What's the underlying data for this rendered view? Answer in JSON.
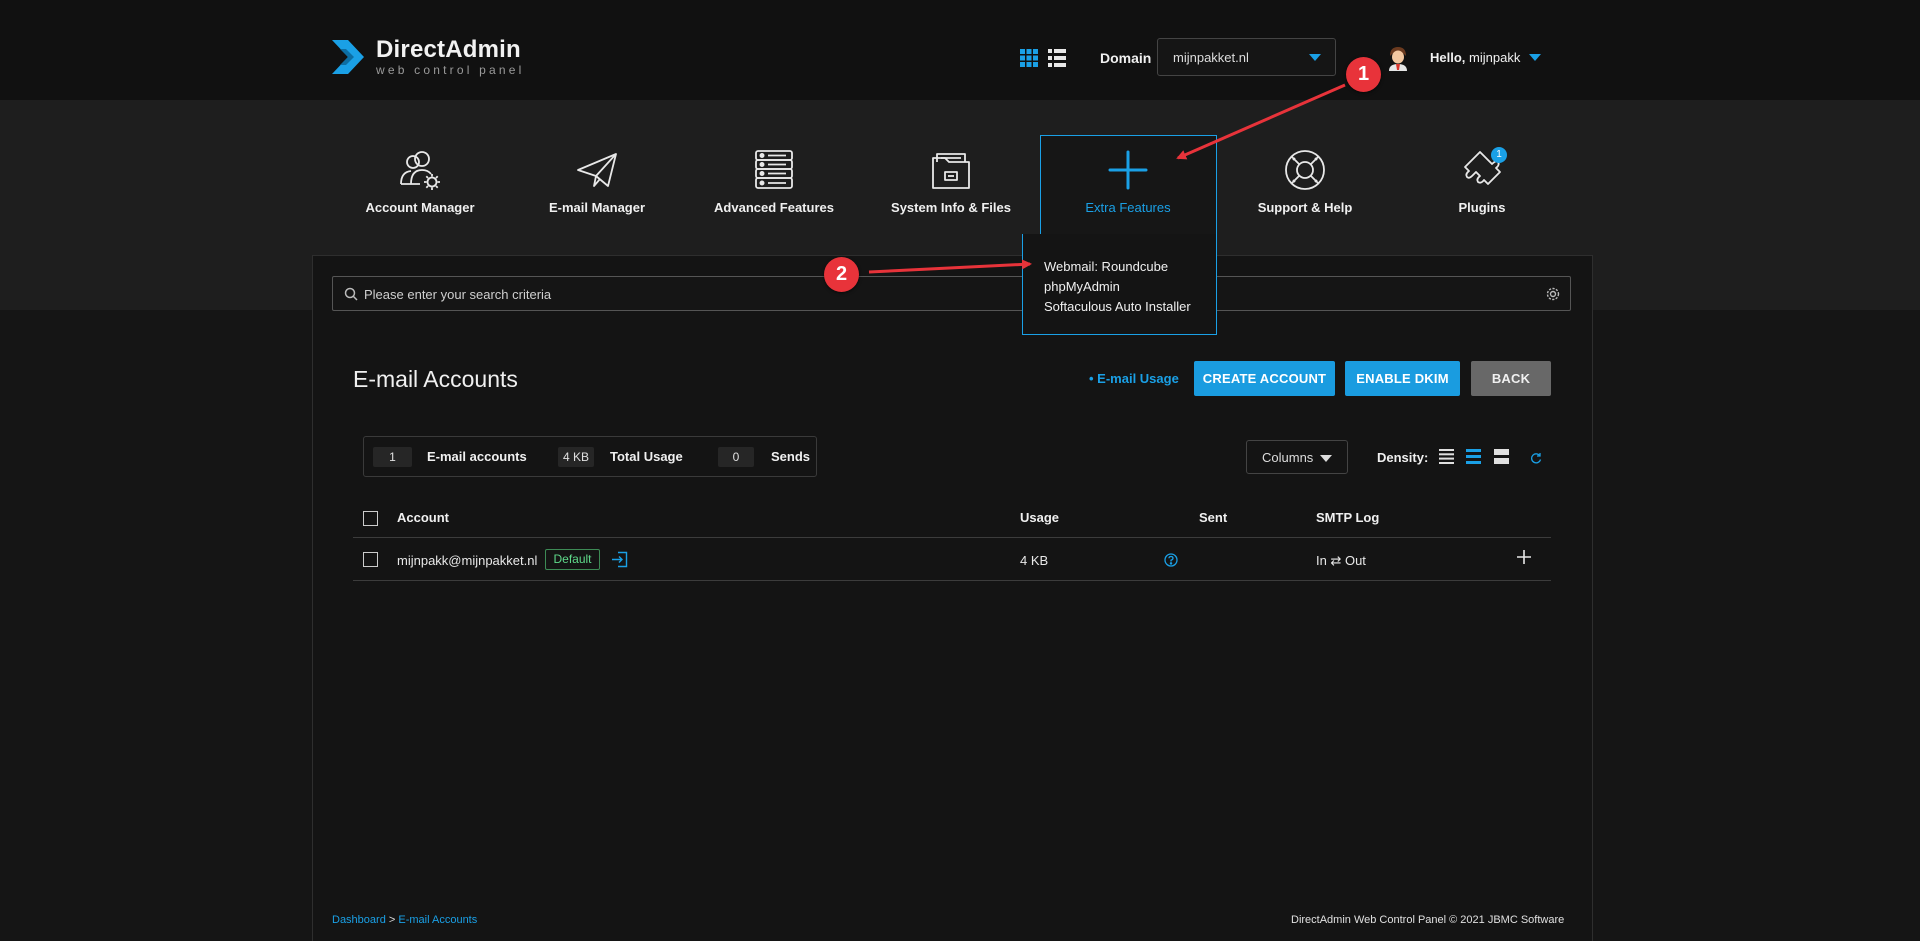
{
  "header": {
    "logo_name": "DirectAdmin",
    "logo_sub": "web control panel",
    "domain_label": "Domain",
    "domain_value": "mijnpakket.nl",
    "hello_prefix": "Hello,",
    "username": "mijnpakk"
  },
  "nav": {
    "items": [
      {
        "label": "Account Manager",
        "icon": "users-gear-icon"
      },
      {
        "label": "E-mail Manager",
        "icon": "paper-plane-icon"
      },
      {
        "label": "Advanced Features",
        "icon": "server-icon"
      },
      {
        "label": "System Info & Files",
        "icon": "folder-icon"
      },
      {
        "label": "Extra Features",
        "icon": "plus-icon",
        "active": true
      },
      {
        "label": "Support & Help",
        "icon": "lifebuoy-icon"
      },
      {
        "label": "Plugins",
        "icon": "puzzle-icon",
        "badge": "1"
      }
    ],
    "extra_menu": [
      "Webmail: Roundcube",
      "phpMyAdmin",
      "Softaculous Auto Installer"
    ]
  },
  "search": {
    "placeholder": "Please enter your search criteria"
  },
  "page": {
    "title": "E-mail Accounts",
    "usage_link": "• E-mail Usage",
    "create_label": "CREATE ACCOUNT",
    "dkim_label": "ENABLE DKIM",
    "back_label": "BACK"
  },
  "stats": {
    "accounts_count": "1",
    "accounts_label": "E-mail accounts",
    "usage_value": "4 KB",
    "usage_label": "Total Usage",
    "sends_value": "0",
    "sends_label": "Sends"
  },
  "table_controls": {
    "columns_label": "Columns",
    "density_label": "Density:"
  },
  "table": {
    "headers": [
      "Account",
      "Usage",
      "Sent",
      "SMTP Log"
    ],
    "rows": [
      {
        "account": "mijnpakk@mijnpakket.nl",
        "tag": "Default",
        "usage": "4 KB",
        "smtp": "In ⇄ Out"
      }
    ]
  },
  "footer": {
    "breadcrumb_home": "Dashboard",
    "breadcrumb_sep": " > ",
    "breadcrumb_current": "E-mail Accounts",
    "copyright": "DirectAdmin Web Control Panel © 2021 JBMC Software"
  },
  "annotations": {
    "callout_1": "1",
    "callout_2": "2"
  },
  "colors": {
    "accent": "#1aa0e6",
    "callout": "#e8333a",
    "success": "#5fd98a",
    "neutral_button": "#686868"
  }
}
